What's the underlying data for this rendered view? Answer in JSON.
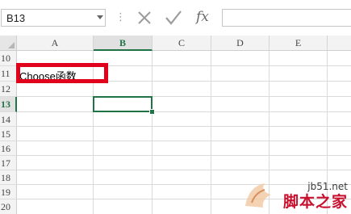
{
  "formula_bar": {
    "name_box": "B13",
    "separator": "⋮",
    "fx_label": "fx",
    "formula": ""
  },
  "columns": [
    "A",
    "B",
    "C",
    "D",
    "E"
  ],
  "selected_column": "B",
  "rows": [
    "10",
    "11",
    "12",
    "13",
    "14",
    "15",
    "16",
    "17",
    "18",
    "19",
    "20"
  ],
  "selected_row": "13",
  "cells": {
    "A11": "Choose函数"
  },
  "watermark": {
    "site": "jb51.net",
    "brand": "脚本之家"
  },
  "colors": {
    "accent": "#217346",
    "highlight": "#e0001b"
  }
}
